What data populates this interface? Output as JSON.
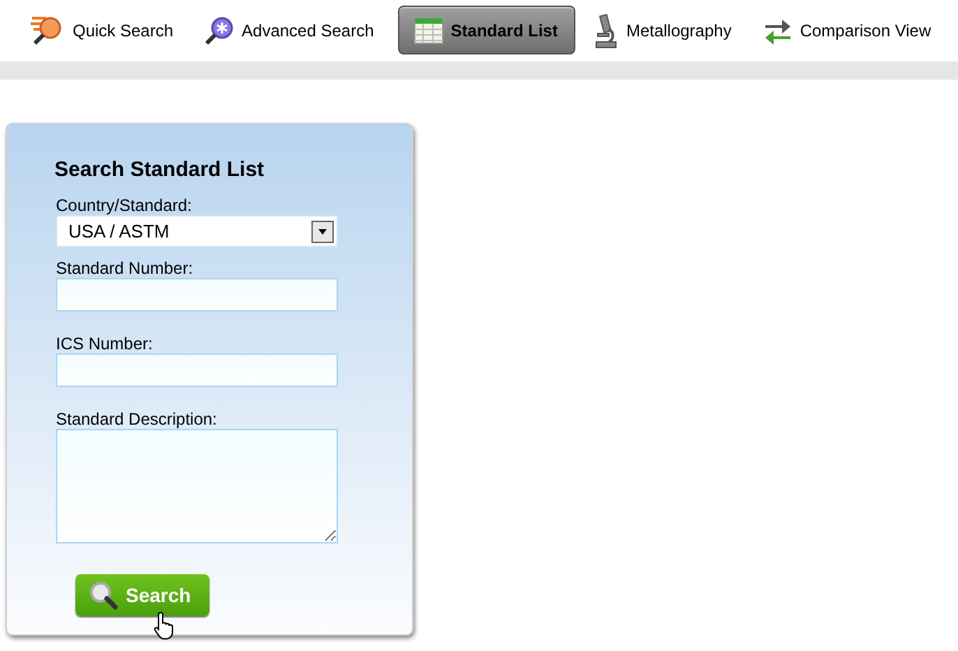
{
  "tabs": [
    {
      "label": "Quick Search",
      "selected": false
    },
    {
      "label": "Advanced Search",
      "selected": false
    },
    {
      "label": "Standard List",
      "selected": true
    },
    {
      "label": "Metallography",
      "selected": false
    },
    {
      "label": "Comparison View",
      "selected": false
    }
  ],
  "search_panel": {
    "title": "Search Standard List",
    "fields": [
      {
        "kind": "select",
        "label": "Country/Standard:",
        "value": "USA / ASTM"
      },
      {
        "kind": "text",
        "label": "Standard Number:"
      },
      {
        "kind": "text",
        "label": "ICS Number:"
      },
      {
        "kind": "textarea",
        "label": "Standard Description:"
      }
    ],
    "button": "Search"
  }
}
